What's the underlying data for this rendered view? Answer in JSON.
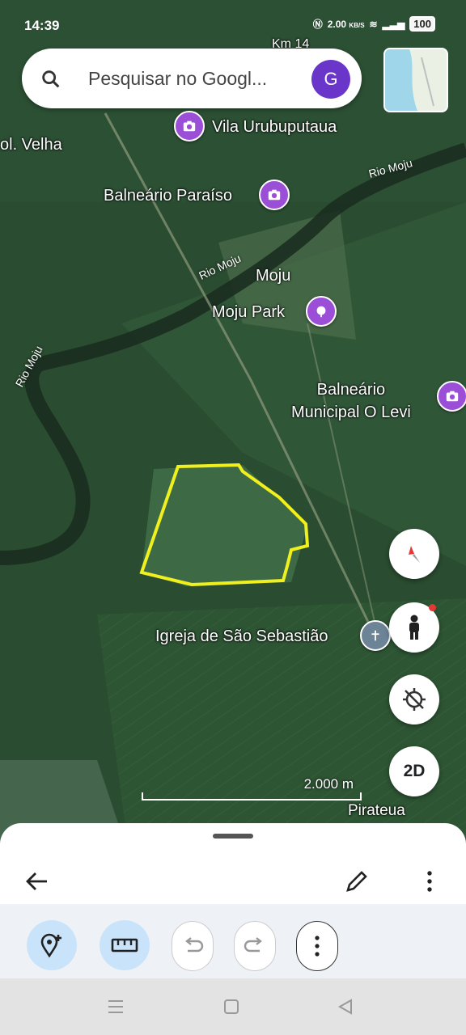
{
  "status": {
    "time": "14:39",
    "network_speed": "2.00",
    "network_unit": "KB/S",
    "battery": "100"
  },
  "search": {
    "placeholder": "Pesquisar no Googl...",
    "avatar_letter": "G"
  },
  "map_labels": {
    "km": "Km 14",
    "vila": "Vila Urubuputaua",
    "col_velha": "ol. Velha",
    "balneario_paraiso": "Balneário Paraíso",
    "rio_moju_1": "Rio Moju",
    "rio_moju_2": "Rio Moju",
    "rio_moju_3": "Rio Moju",
    "moju": "Moju",
    "moju_park": "Moju Park",
    "balneario_municipal": "Balneário\nMunicipal O Levi",
    "igreja": "Igreja de São Sebastião",
    "pirateua": "Pirateua"
  },
  "scale": {
    "label": "2.000 m"
  },
  "controls": {
    "view_mode": "2D"
  },
  "icons": {
    "search": "search-icon",
    "compass": "compass-icon",
    "pegman": "pegman-icon",
    "location": "location-off-icon",
    "back": "back-arrow-icon",
    "edit": "pencil-icon",
    "more": "more-vert-icon",
    "add_place": "add-place-icon",
    "measure": "ruler-icon",
    "undo": "undo-icon",
    "redo": "redo-icon"
  },
  "colors": {
    "polygon": "#f0f01e",
    "pin_purple": "#9b4fd6",
    "avatar": "#6a35c9"
  }
}
